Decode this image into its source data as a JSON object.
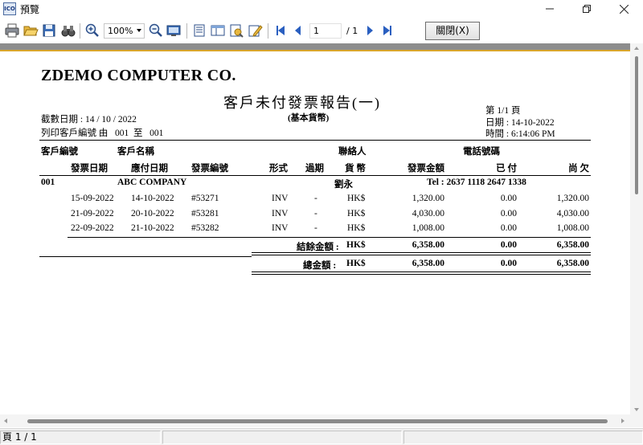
{
  "window": {
    "title": "預覽",
    "app_icon_text": "ICO"
  },
  "toolbar": {
    "zoom": "100%",
    "page_current": "1",
    "page_total": "/ 1",
    "close_label": "關閉(X)"
  },
  "report": {
    "company": "ZDEMO COMPUTER CO.",
    "title": "客戶未付發票報告(一)",
    "subtitle": "(基本貨幣)",
    "cutoff": "截數日期 : 14 / 10 / 2022",
    "customer_range": "列印客戶編號 由   001  至   001",
    "page": "第 1/1 頁",
    "print_date": "日期 : 14-10-2022",
    "print_time": "時間 : 6:14:06 PM",
    "header1": {
      "cust_no": "客戶編號",
      "cust_name": "客戶名稱",
      "contact": "聯絡人",
      "phone": "電話號碼"
    },
    "header2": {
      "inv_date": "發票日期",
      "due_date": "應付日期",
      "inv_no": "發票編號",
      "type": "形式",
      "overdue": "過期",
      "currency": "貨 幣",
      "amount": "發票金額",
      "paid": "已 付",
      "owing": "尚 欠"
    },
    "customer": {
      "no": "001",
      "name": "ABC COMPANY",
      "contact": "劉永",
      "tel": "Tel : 2637 1118 2647 1338"
    },
    "rows": [
      {
        "inv_date": "15-09-2022",
        "due_date": "14-10-2022",
        "inv_no": "#53271",
        "type": "INV",
        "overdue": "-",
        "currency": "HK$",
        "amount": "1,320.00",
        "paid": "0.00",
        "owing": "1,320.00"
      },
      {
        "inv_date": "21-09-2022",
        "due_date": "20-10-2022",
        "inv_no": "#53281",
        "type": "INV",
        "overdue": "-",
        "currency": "HK$",
        "amount": "4,030.00",
        "paid": "0.00",
        "owing": "4,030.00"
      },
      {
        "inv_date": "22-09-2022",
        "due_date": "21-10-2022",
        "inv_no": "#53282",
        "type": "INV",
        "overdue": "-",
        "currency": "HK$",
        "amount": "1,008.00",
        "paid": "0.00",
        "owing": "1,008.00"
      }
    ],
    "subtotal": {
      "label": "結餘金額 :",
      "currency": "HK$",
      "amount": "6,358.00",
      "paid": "0.00",
      "owing": "6,358.00"
    },
    "total": {
      "label": "總金額 :",
      "currency": "HK$",
      "amount": "6,358.00",
      "paid": "0.00",
      "owing": "6,358.00"
    }
  },
  "status": {
    "page": "頁 1 / 1"
  }
}
